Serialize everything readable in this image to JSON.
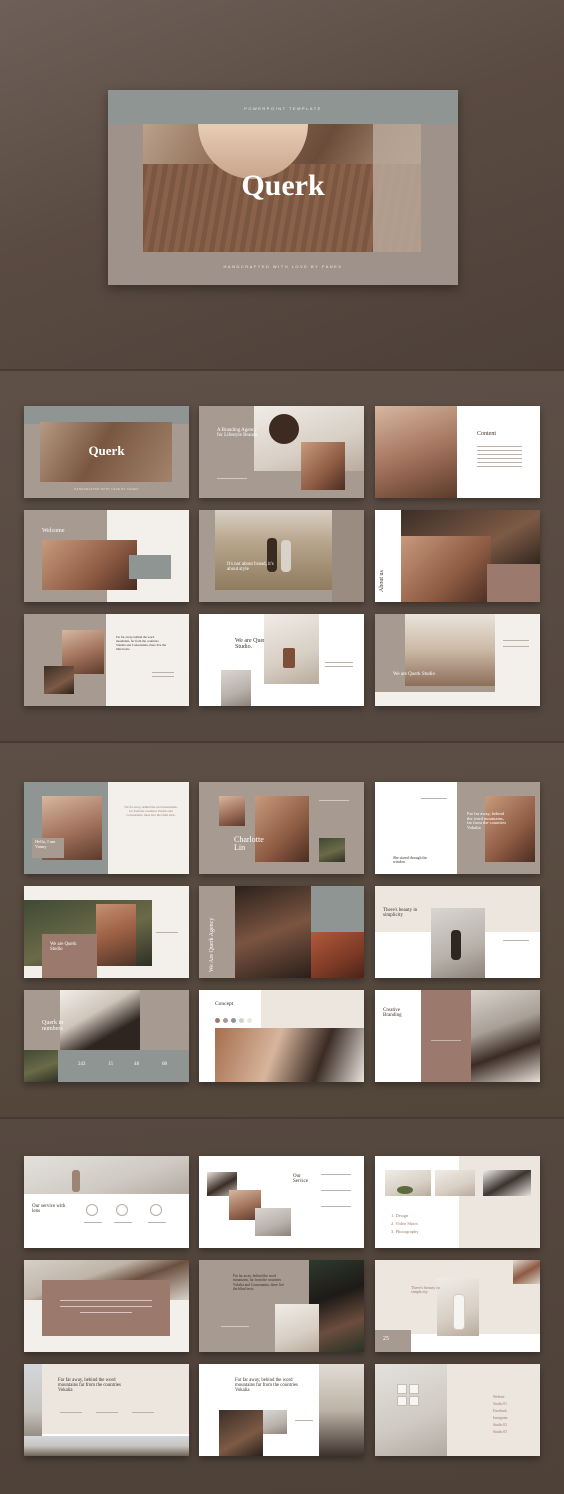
{
  "hero": {
    "top_label": "POWERPOINT TEMPLATE",
    "title": "Querk",
    "bottom_label": "HANDCRAFTED WITH LOVE BY FANEX"
  },
  "section1": {
    "s1_title": "Querk",
    "s1_sub": "HANDCRAFTED WITH LOVE BY FANEX",
    "s2_heading": "A Branding Agency for Lifestyle Brands",
    "s3_heading": "Content",
    "s4_heading": "Welcome",
    "s5_heading": "It's not about brand, it's about style",
    "s6_heading": "About us",
    "s7_heading": "Far far away, behind the word mountains, far from the countries Vokalia and Consonantia, there live the blind texts.",
    "s8_heading": "We are Querk Studio.",
    "s9_heading": "We are Querk Studio"
  },
  "section2": {
    "s1_heading": "Hello, I am Vanny",
    "s1_quote": "Far far away, behind the word mountains, far from the countries Vokalia and Consonantia, there live the blind texts.",
    "s2_heading": "Charlotte Lin",
    "s3_heading": "Far far away, behind the word mountains, far from the countries Vokalia",
    "s3_sub": "She stared through the window",
    "s4_heading": "We are Querk Studio",
    "s5_heading": "We Are Querk Agency",
    "s6_heading": "There's beauty in simplicity",
    "s7_heading": "Querk in numbers",
    "s7_stats": [
      "243",
      "15",
      "48",
      "68"
    ],
    "s8_heading": "Concept",
    "s9_heading": "Creative Branding"
  },
  "section3": {
    "s1_heading": "Our service with lens",
    "s2_heading": "Our Service",
    "s3_list": [
      "1. Design",
      "2. Video Shoot",
      "3. Photography"
    ],
    "s5_heading": "Far far away, behind the word mountains, far from the countries Vokalia and Consonantia, there live the blind texts",
    "s6_heading": "There's beauty in simplicity",
    "s6_number": "25",
    "s7_heading": "Far far away, behind the word mountains far from the countries Vokalia",
    "s8_heading": "Far far away, behind the word mountains far from the countries Vokalia",
    "s9_list": [
      "Website",
      "Studio 01",
      "Facebook",
      "Instagram",
      "Studio 02",
      "Studio 03"
    ]
  },
  "brand_small": "Querk",
  "colors": {
    "background": "#5b4d44",
    "taupe": "#a79a91",
    "rose": "#9b7a6d",
    "slate": "#8e9593",
    "cream": "#f3efea"
  }
}
